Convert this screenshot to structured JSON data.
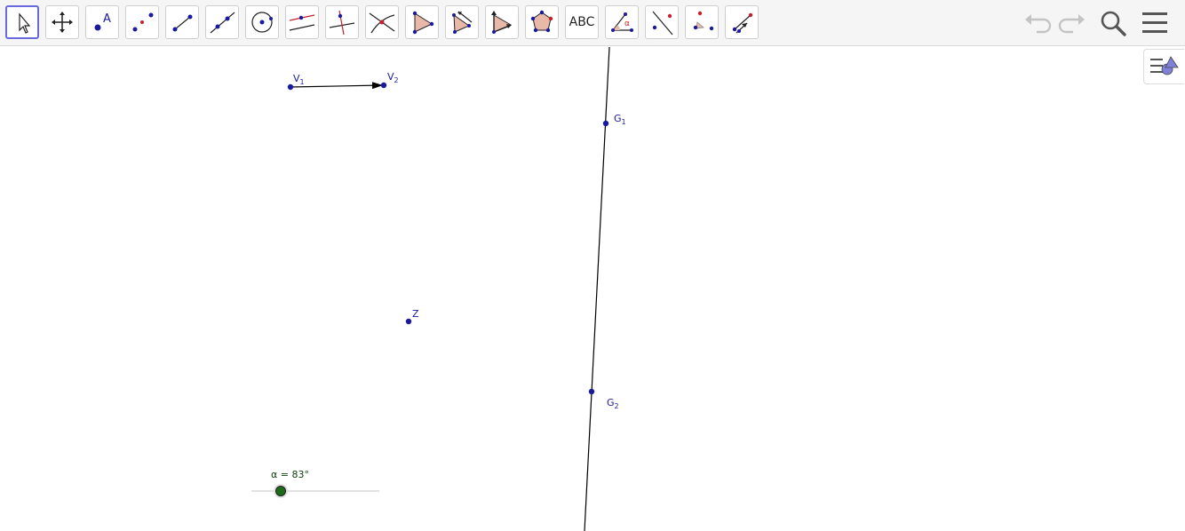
{
  "toolbar": {
    "tools": [
      {
        "name": "move-tool",
        "icon": "arrow-cursor-icon",
        "selected": true
      },
      {
        "name": "move-graphics-view-tool",
        "icon": "move-arrows-icon"
      },
      {
        "name": "point-tool",
        "icon": "point-a-icon",
        "text": "A"
      },
      {
        "name": "point-on-object-tool",
        "icon": "two-points-icon"
      },
      {
        "name": "segment-tool",
        "icon": "segment-icon"
      },
      {
        "name": "line-tool",
        "icon": "line-icon"
      },
      {
        "name": "circle-tool",
        "icon": "circle-center-icon"
      },
      {
        "name": "parallel-line-tool",
        "icon": "parallel-line-icon"
      },
      {
        "name": "perpendicular-line-tool",
        "icon": "perpendicular-line-icon"
      },
      {
        "name": "intersect-tool",
        "icon": "intersect-icon"
      },
      {
        "name": "polygon-tool",
        "icon": "polygon-icon"
      },
      {
        "name": "reflect-tool",
        "icon": "reflect-triangle-icon"
      },
      {
        "name": "rotate-tool",
        "icon": "rotate-triangle-icon"
      },
      {
        "name": "regular-polygon-tool",
        "icon": "regular-polygon-icon"
      },
      {
        "name": "text-tool",
        "icon": "text-icon",
        "text": "ABC"
      },
      {
        "name": "angle-tool",
        "icon": "angle-icon",
        "text": "α"
      },
      {
        "name": "perpendicular-bisector-tool",
        "icon": "bisector-icon"
      },
      {
        "name": "dilate-tool",
        "icon": "dilate-icon"
      },
      {
        "name": "vector-tool",
        "icon": "vector-icon"
      }
    ],
    "undo_icon": "undo-icon",
    "redo_icon": "redo-icon",
    "search_icon": "search-icon",
    "menu_icon": "hamburger-menu-icon"
  },
  "colors": {
    "point": "#1a1aa0",
    "line": "#000000",
    "slider": "#1b6b1b",
    "tool_selected_border": "#6a6adf",
    "polygon_fill": "#e8b8a8",
    "red_point": "#c8202a"
  },
  "canvas": {
    "labels": {
      "v1": {
        "base": "V",
        "sub": "1"
      },
      "v2": {
        "base": "V",
        "sub": "2"
      },
      "g1": {
        "base": "G",
        "sub": "1"
      },
      "g2": {
        "base": "G",
        "sub": "2"
      },
      "z": "Z"
    },
    "slider": {
      "label": "α = 83°",
      "value": 83
    }
  }
}
